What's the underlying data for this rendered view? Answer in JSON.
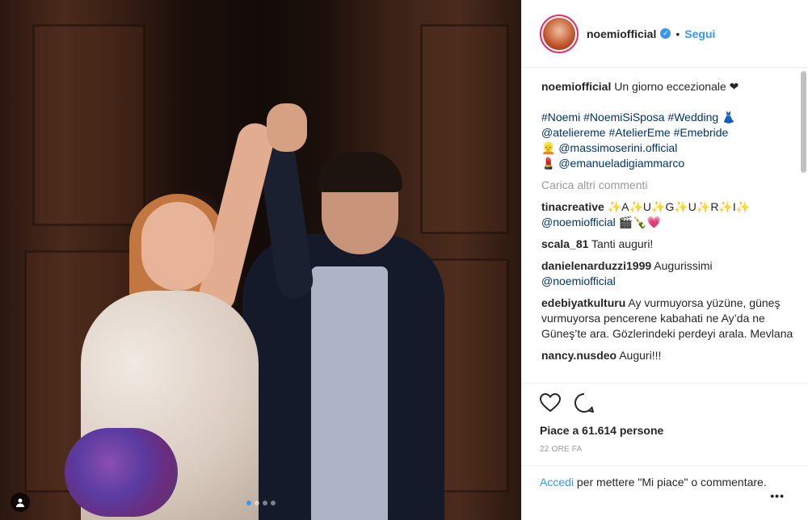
{
  "post": {
    "username": "noemiofficial",
    "verified_mark": "✓",
    "separator": "•",
    "follow_label": "Segui"
  },
  "caption": {
    "user": "noemiofficial",
    "text": "Un giorno eccezionale ❤",
    "line1": "#Noemi #NoemiSiSposa #Wedding 👗",
    "line2": "@ateliereme #AtelierEme #Emebride",
    "line3_emoji": "👱",
    "line3_tag": "@massimoserini.official",
    "line4_emoji": "💄",
    "line4_tag": "@emanueladigiammarco"
  },
  "load_more": "Carica altri commenti",
  "comments": [
    {
      "user": "tinacreative",
      "text": "✨A✨U✨G✨U✨R✨I✨ ",
      "tag": "@noemiofficial",
      "tail": " 🎬🍾💗"
    },
    {
      "user": "scala_81",
      "text": "Tanti auguri!"
    },
    {
      "user": "danielenarduzzi1999",
      "text": "Augurissimi",
      "tag": "@noemiofficial"
    },
    {
      "user": "edebiyatkulturu",
      "text": "Ay vurmuyorsa yüzüne, güneş vurmuyorsa pencerene kabahati ne Ay’da ne Güneş’te ara. Gözlerindeki perdeyi arala. Mevlana"
    },
    {
      "user": "nancy.nusdeo",
      "text": "Auguri!!!"
    }
  ],
  "actions": {
    "likes": "Piace a 61.614 persone",
    "time": "22 ORE FA"
  },
  "footer": {
    "login": "Accedi",
    "text": " per mettere \"Mi piace\" o commentare.",
    "more": "•••"
  },
  "carousel": {
    "count": 4,
    "active": 0
  }
}
